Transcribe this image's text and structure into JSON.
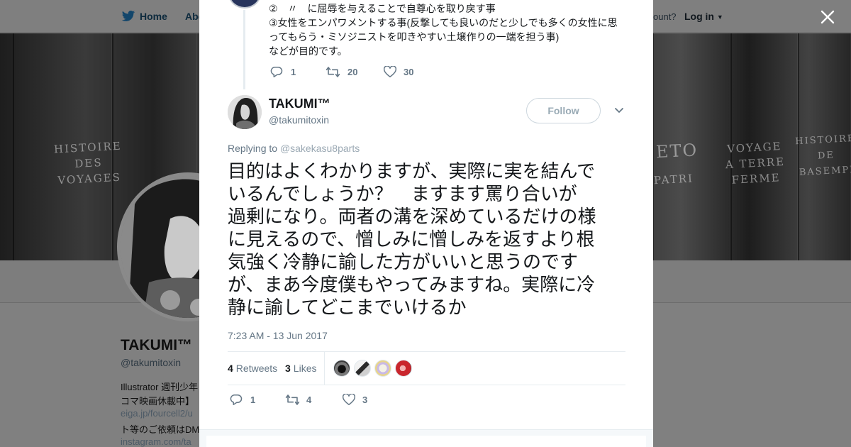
{
  "nav": {
    "home_label": "Home",
    "about_label": "Abo",
    "account_prompt": "ount?",
    "login_label": "Log in"
  },
  "banner": {
    "spines": [
      {
        "text": "HISTOIRE\nDES\nVOYAGES"
      },
      {
        "text": "VOYAGE\nA TERRE\nFERME"
      },
      {
        "text": "HISTOIRE\nDE\nBASEMPI"
      },
      {
        "text": "PATRI"
      },
      {
        "text": "ETO"
      }
    ]
  },
  "background_profile": {
    "name": "TAKUMI™",
    "handle": "@takumitoxin",
    "bio_lines": [
      {
        "text": "Illustrator 週刊少年",
        "is_link": false
      },
      {
        "text": "コマ映画休載中】",
        "is_link": false
      },
      {
        "text": "eiga.jp/fourcell2/u",
        "is_link": true
      },
      {
        "text": "ト等のご依頼はDM",
        "is_link": false
      },
      {
        "text": "instagram.com/ta",
        "is_link": true
      }
    ]
  },
  "previous_tweet": {
    "lines": [
      "②　〃　に屈辱を与えることで自尊心を取り戻す事",
      "③女性をエンパワメントする事(反撃しても良いのだと少しでも多くの女性に思",
      "ってもらう・ミソジニストを叩きやすい土壌作りの一端を担う事)",
      "などが目的です。"
    ],
    "reply_count": "1",
    "retweet_count": "20",
    "like_count": "30"
  },
  "tweet": {
    "display_name": "TAKUMI™",
    "screen_name": "@takumitoxin",
    "follow_label": "Follow",
    "replying_prefix": "Replying to",
    "replying_to": "@sakekasu8parts",
    "text_lines": [
      "目的はよくわかりますが、実際に実を結んで",
      "いるんでしょうか？　ますます罵り合いが",
      "過剰になり。両者の溝を深めているだけの様",
      "に見えるので、憎しみに憎しみを返すより根",
      "気強く冷静に諭した方がいいと思うのです",
      "が、まあ今度僕もやってみますね。実際に冷",
      "静に諭してどこまでいけるか"
    ],
    "timestamp": "7:23 AM - 13 Jun 2017",
    "retweets_value": "4",
    "retweets_label": "Retweets",
    "likes_value": "3",
    "likes_label": "Likes",
    "reply_count": "1",
    "retweet_count": "4",
    "like_count": "3"
  },
  "colors": {
    "twitter_blue": "#1da1f2",
    "muted_text": "#657786",
    "main_text": "#14171a",
    "divider": "#e6ecf0",
    "overlay_bg": "#7f7f7f"
  },
  "icons": {
    "logo": "twitter-bird-icon",
    "close": "close-icon",
    "reply": "reply-icon",
    "retweet": "retweet-icon",
    "like": "heart-icon",
    "menu": "chevron-down-icon"
  }
}
